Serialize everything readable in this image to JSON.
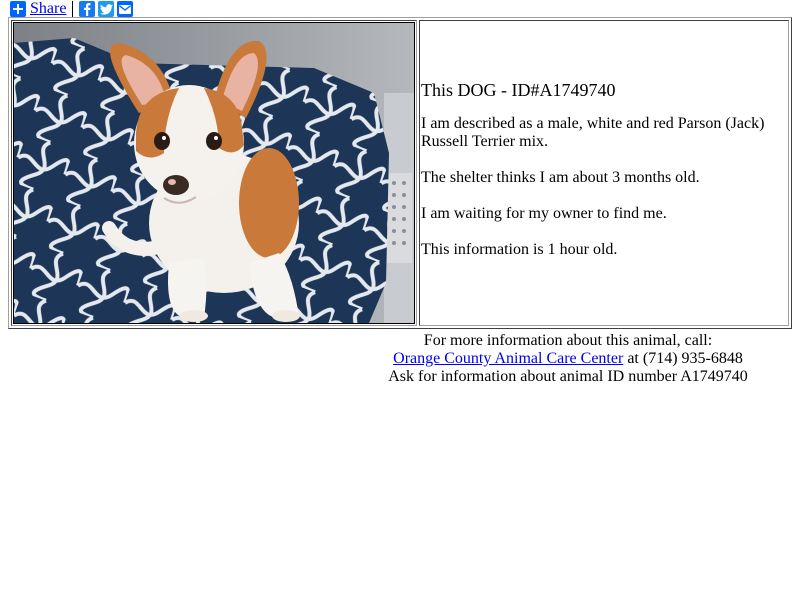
{
  "share_bar": {
    "share_label": "Share",
    "icons": [
      "plus-icon",
      "facebook-icon",
      "twitter-icon",
      "email-icon"
    ]
  },
  "animal": {
    "photo_alt": "Photo of a white and red puppy sitting on a blue patterned blanket",
    "title": "This DOG - ID#A1749740",
    "description": "I am described as a male, white and red Parson (Jack) Russell Terrier mix.",
    "age": "The shelter thinks I am about 3 months old.",
    "status": "I am waiting for my owner to find me.",
    "freshness": "This information is 1 hour old."
  },
  "contact": {
    "line1": "For more information about this animal, call:",
    "shelter_name": "Orange County Animal Care Center",
    "phone_text": " at (714) 935-6848",
    "line3": "Ask for information about animal ID number A1749740"
  },
  "colors": {
    "link": "#0000ee",
    "share_blue": "#0166ff",
    "facebook": "#1877f2",
    "twitter": "#1d9bf0"
  }
}
